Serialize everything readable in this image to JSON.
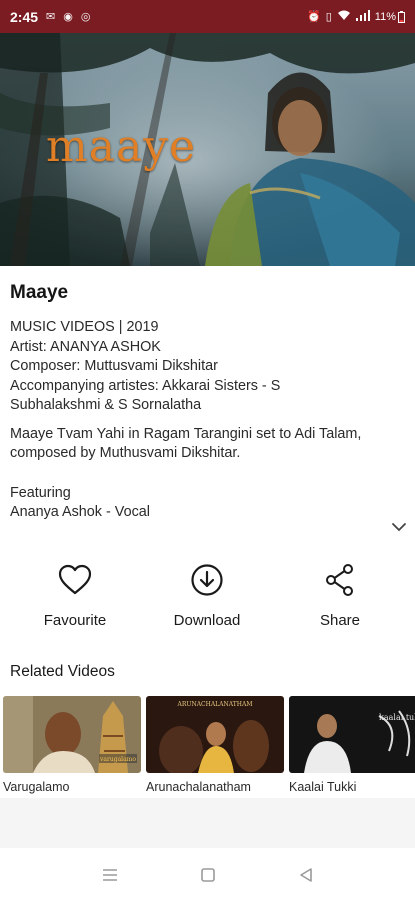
{
  "status_bar": {
    "time": "2:45",
    "battery": "11%"
  },
  "hero": {
    "title_text": "maaye"
  },
  "details": {
    "title": "Maaye",
    "category_year": "MUSIC VIDEOS | 2019",
    "artist": "Artist: ANANYA ASHOK",
    "composer": "Composer: Muttusvami Dikshitar",
    "accompanying_line1": "Accompanying artistes: Akkarai Sisters - S",
    "accompanying_line2": "Subhalakshmi & S Sornalatha",
    "description_line1": "Maaye Tvam Yahi in Ragam Tarangini set to Adi Talam,",
    "description_line2": "composed by Muthusvami Dikshitar.",
    "featuring_label": "Featuring",
    "featuring_value": "Ananya Ashok - Vocal"
  },
  "actions": {
    "favourite": "Favourite",
    "download": "Download",
    "share": "Share"
  },
  "related": {
    "title": "Related Videos",
    "items": [
      {
        "caption": "Varugalamo",
        "thumb_text": "varugalamo"
      },
      {
        "caption": "Arunachalanatham",
        "thumb_text": "ARUNACHALANATHAM"
      },
      {
        "caption": "Kaalai Tukki",
        "thumb_text": "kaalai tukki"
      }
    ]
  },
  "colors": {
    "status_bar": "#7a1c22",
    "hero_title": "#e07f25"
  }
}
